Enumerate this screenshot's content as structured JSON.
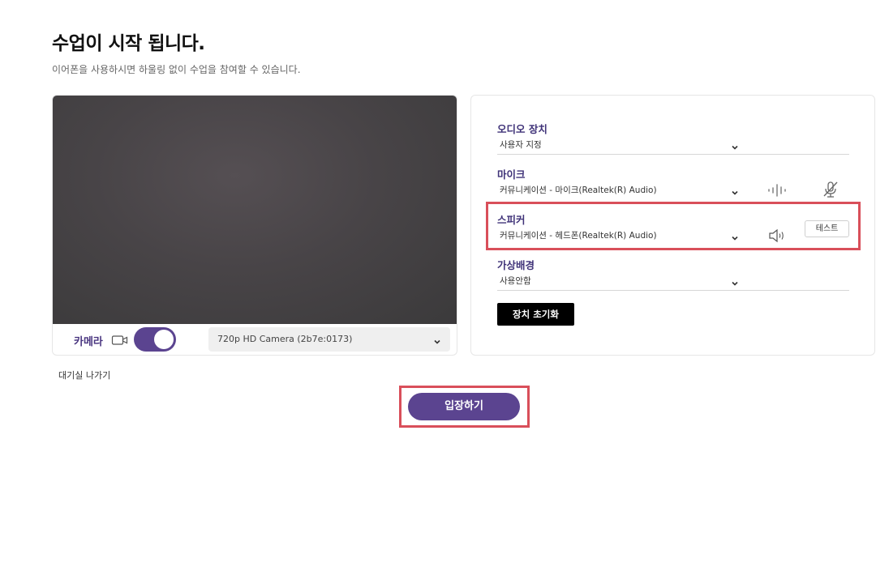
{
  "header": {
    "title": "수업이 시작 됩니다.",
    "subtitle": "이어폰을 사용하시면 하울링 없이 수업을 참여할 수 있습니다."
  },
  "camera": {
    "label": "카메라",
    "toggle_on": true,
    "device": "720p HD Camera (2b7e:0173)"
  },
  "settings": {
    "audio_device": {
      "label": "오디오 장치",
      "value": "사용자 지정"
    },
    "mic": {
      "label": "마이크",
      "value": "커뮤니케이션 - 마이크(Realtek(R) Audio)"
    },
    "speaker": {
      "label": "스피커",
      "value": "커뮤니케이션 - 헤드폰(Realtek(R) Audio)",
      "test_label": "테스트"
    },
    "background": {
      "label": "가상배경",
      "value": "사용안함"
    },
    "reset_label": "장치 초기화"
  },
  "footer": {
    "exit_label": "대기실 나가기",
    "enter_label": "입장하기"
  },
  "colors": {
    "accent": "#5b4490",
    "label": "#3f3278",
    "highlight": "#d94f5a"
  },
  "icons": [
    "camera-icon",
    "chevron-down-icon",
    "mic-level-icon",
    "mic-muted-icon",
    "speaker-icon"
  ]
}
